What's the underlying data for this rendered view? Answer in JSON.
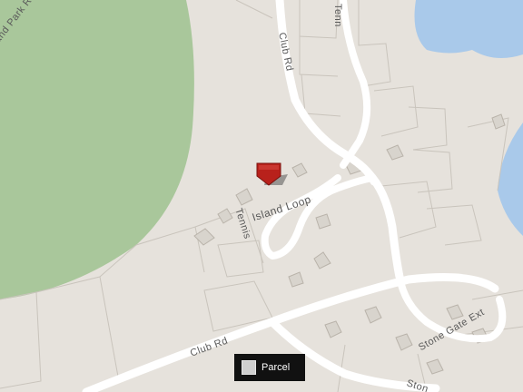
{
  "map": {
    "colors": {
      "land": "#e6e2dc",
      "park": "#a9c79b",
      "water": "#a9c9ea",
      "road": "#ffffff",
      "parcel_line": "#c9c4bc",
      "building": "#d8d4cd",
      "pin": "#b8211b"
    },
    "roads": {
      "club_rd_upper": "Club Rd",
      "club_rd_lower": "Club Rd",
      "tennis_island_loop": "Island Loop",
      "tennis_vertical": "Tennis",
      "tennis_top": "Tenn",
      "stone_gate_ext": "Stone Gate Ext",
      "park_rd": "and Park Ro",
      "stone_bottom": "Ston"
    },
    "marker_icon": "location-pin-icon"
  },
  "legend": {
    "label": "Parcel",
    "swatch_icon": "parcel-swatch-icon"
  }
}
